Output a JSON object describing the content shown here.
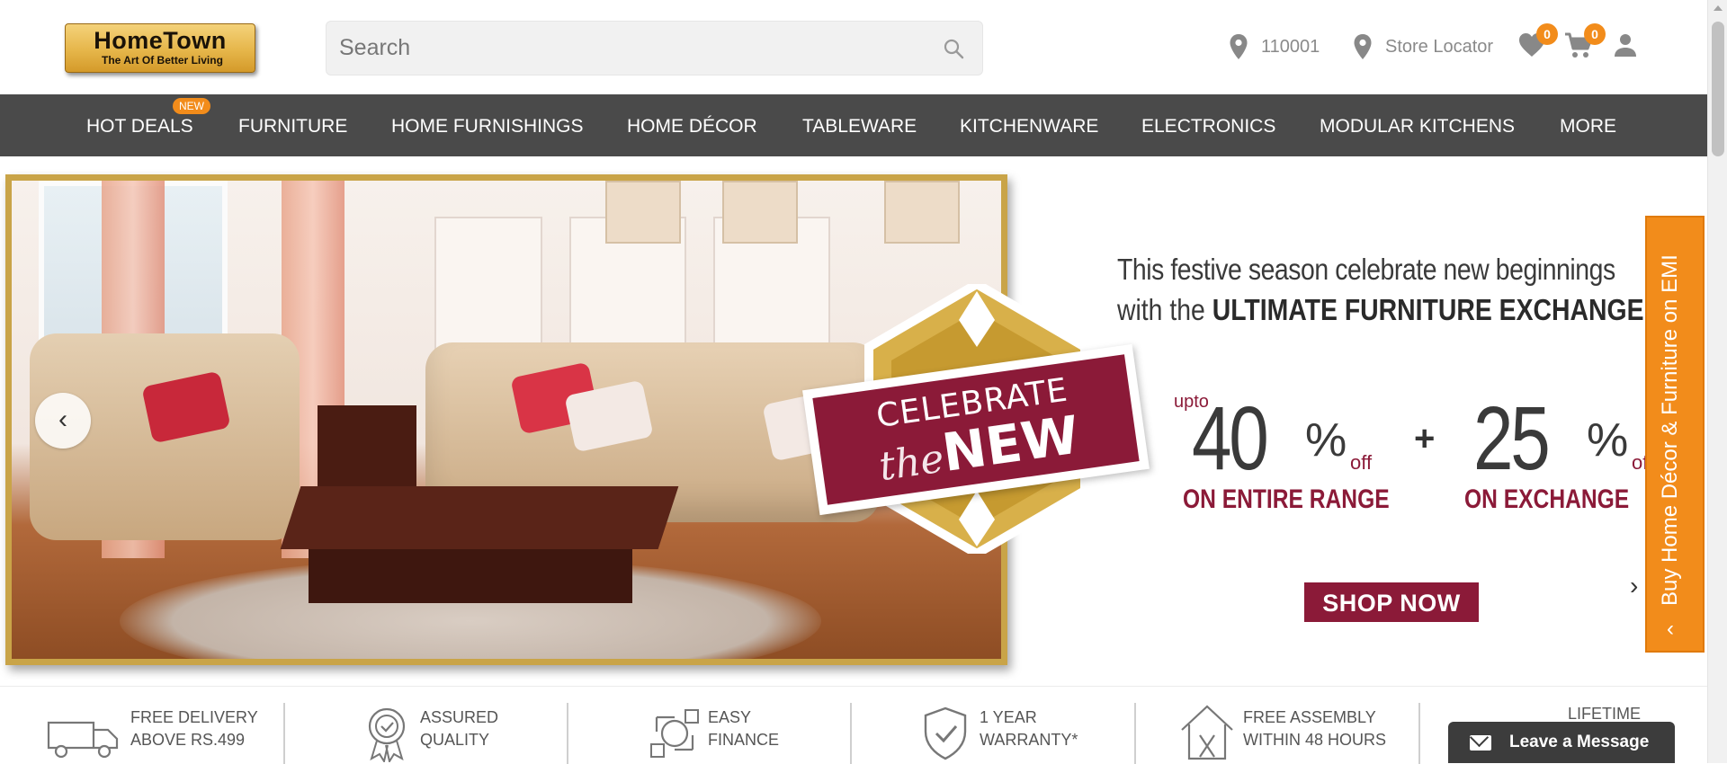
{
  "brand": {
    "name": "HomeTown",
    "tagline": "The Art Of Better Living"
  },
  "header": {
    "search_placeholder": "Search",
    "pincode": "110001",
    "store_locator": "Store Locator",
    "wishlist_count": "0",
    "cart_count": "0"
  },
  "nav": {
    "new_badge": "NEW",
    "items": [
      {
        "label": "HOT DEALS"
      },
      {
        "label": "FURNITURE"
      },
      {
        "label": "HOME FURNISHINGS"
      },
      {
        "label": "HOME DÉCOR"
      },
      {
        "label": "TABLEWARE"
      },
      {
        "label": "KITCHENWARE"
      },
      {
        "label": "ELECTRONICS"
      },
      {
        "label": "MODULAR KITCHENS"
      },
      {
        "label": "MORE"
      }
    ]
  },
  "banner": {
    "ribbon_top": "CELEBRATE",
    "ribbon_script": "the",
    "ribbon_new": "NEW",
    "line1": "This festive season celebrate new beginnings",
    "line2_pre": "with the ",
    "line2_bold": "ULTIMATE FURNITURE EXCHANGE!",
    "offer1": {
      "upto": "upto",
      "value": "40",
      "pct": "%",
      "off": "off",
      "caption": "ON ENTIRE RANGE"
    },
    "plus": "+",
    "offer2": {
      "value": "25",
      "pct": "%",
      "off": "off",
      "caption": "ON EXCHANGE"
    },
    "cta": "SHOP NOW",
    "prev_glyph": "‹",
    "next_glyph": "›"
  },
  "emi_tab": {
    "label": "Buy Home Décor & Furniture on EMI",
    "chevron": "‹"
  },
  "features": [
    {
      "line1": "FREE DELIVERY",
      "line2": "ABOVE RS.499"
    },
    {
      "line1": "ASSURED",
      "line2": "QUALITY"
    },
    {
      "line1": "EASY",
      "line2": "FINANCE"
    },
    {
      "line1": "1 YEAR",
      "line2": "WARRANTY*"
    },
    {
      "line1": "FREE ASSEMBLY",
      "line2": "WITHIN 48 HOURS"
    },
    {
      "line1": "LIFETIME",
      "line2": ""
    }
  ],
  "chat": {
    "label": "Leave a Message"
  },
  "colors": {
    "accent_orange": "#f28c1b",
    "nav_bg": "#4a4a4a",
    "maroon": "#8b1a38",
    "gold": "#c9a448"
  }
}
